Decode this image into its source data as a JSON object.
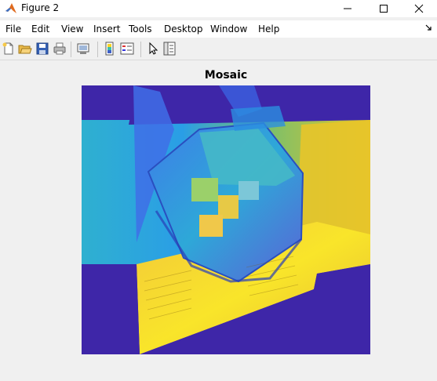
{
  "window": {
    "title": "Figure 2",
    "app_icon": "matlab-logo-icon",
    "controls": [
      "minimize-icon",
      "maximize-icon",
      "close-icon"
    ]
  },
  "menubar": {
    "items": [
      "File",
      "Edit",
      "View",
      "Insert",
      "Tools",
      "Desktop",
      "Window",
      "Help"
    ]
  },
  "toolbar": {
    "buttons": [
      {
        "icon": "new-figure-icon"
      },
      {
        "icon": "open-file-icon"
      },
      {
        "icon": "save-icon"
      },
      {
        "icon": "print-icon"
      },
      {
        "icon": "link-plot-icon"
      },
      {
        "icon": "insert-colorbar-icon"
      },
      {
        "icon": "insert-legend-icon"
      },
      {
        "icon": "edit-plot-pointer-icon"
      },
      {
        "icon": "property-inspector-icon"
      }
    ]
  },
  "figure": {
    "axes_title": "Mosaic",
    "background_color": "#f0f0f0",
    "image_description_colors": {
      "background": "#3e26a8",
      "mid": "#2fb4c6",
      "high": "#f9fb15"
    }
  }
}
